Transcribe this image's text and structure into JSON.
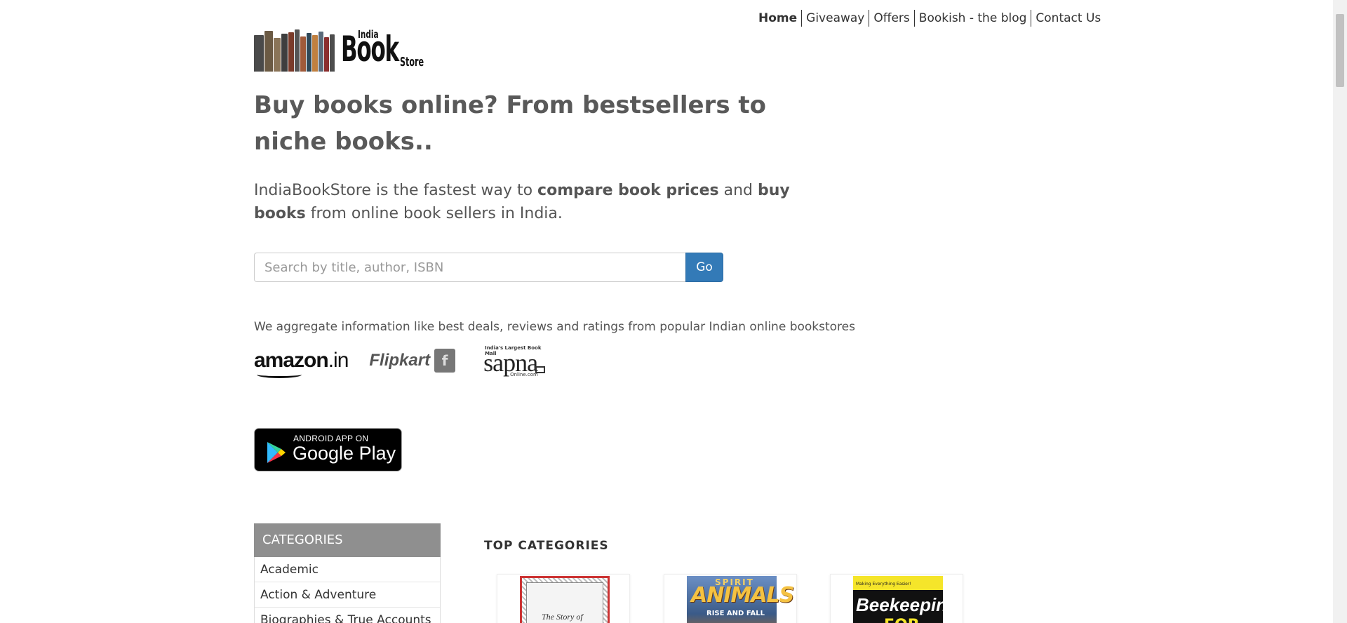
{
  "nav": {
    "items": [
      "Home",
      "Giveaway",
      "Offers",
      "Bookish - the blog",
      "Contact Us"
    ]
  },
  "logo": {
    "line1": "India",
    "line2": "Book",
    "line3": "Store"
  },
  "headline": "Buy books online? From bestsellers to niche books..",
  "intro": {
    "part1": "IndiaBookStore is the fastest way to ",
    "bold1": "compare book prices",
    "part2": " and ",
    "bold2": "buy books",
    "part3": " from online book sellers in India."
  },
  "search": {
    "placeholder": "Search by title, author, ISBN",
    "button": "Go"
  },
  "aggregate_text": "We aggregate information like best deals, reviews and ratings from popular Indian online bookstores",
  "stores": {
    "amazon": "amazon",
    "amazon_suffix": ".in",
    "flipkart": "Flipkart",
    "sapna_tag": "India's Largest Book Mall",
    "sapna": "sapna",
    "sapna_sub": "Online.com"
  },
  "google_play": {
    "small": "ANDROID APP ON",
    "big": "Google Play"
  },
  "categories": {
    "heading": "CATEGORIES",
    "items": [
      "Academic",
      "Action & Adventure",
      "Biographies & True Accounts"
    ]
  },
  "top_categories": {
    "heading": "TOP CATEGORIES",
    "covers": [
      {
        "title": "The Story of"
      },
      {
        "top": "SPIRIT",
        "title": "ANIMALS",
        "sub": "RISE AND FALL"
      },
      {
        "tag": "Making Everything Easier!",
        "title": "Beekeeping",
        "sub": "FOR"
      }
    ]
  },
  "colors": {
    "accent": "#337ab7",
    "category_header": "#8f8f8f",
    "text": "#555555"
  }
}
